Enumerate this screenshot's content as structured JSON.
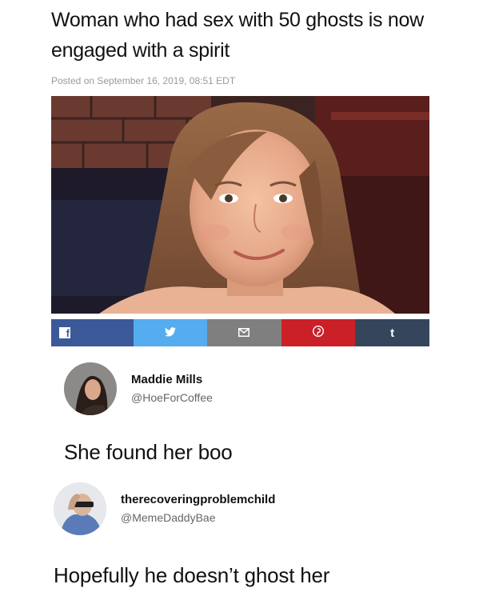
{
  "article": {
    "headline": "Woman who had sex with 50 ghosts is now engaged with a spirit",
    "posted": "Posted on September 16, 2019, 08:51 EDT"
  },
  "share": {
    "buttons": [
      {
        "icon": "facebook-icon",
        "label": "f",
        "color": "#3b5998"
      },
      {
        "icon": "twitter-icon",
        "label": "",
        "color": "#55acee"
      },
      {
        "icon": "email-icon",
        "label": "",
        "color": "#7f7f7f"
      },
      {
        "icon": "pinterest-icon",
        "label": "",
        "color": "#cb2027"
      },
      {
        "icon": "tumblr-icon",
        "label": "t",
        "color": "#35465c"
      }
    ]
  },
  "replies": [
    {
      "name": "Maddie Mills",
      "handle": "@HoeForCoffee",
      "text": "She found her boo"
    },
    {
      "name": "therecoveringproblemchild",
      "handle": "@MemeDaddyBae",
      "text": "Hopefully he doesn’t ghost her"
    }
  ]
}
